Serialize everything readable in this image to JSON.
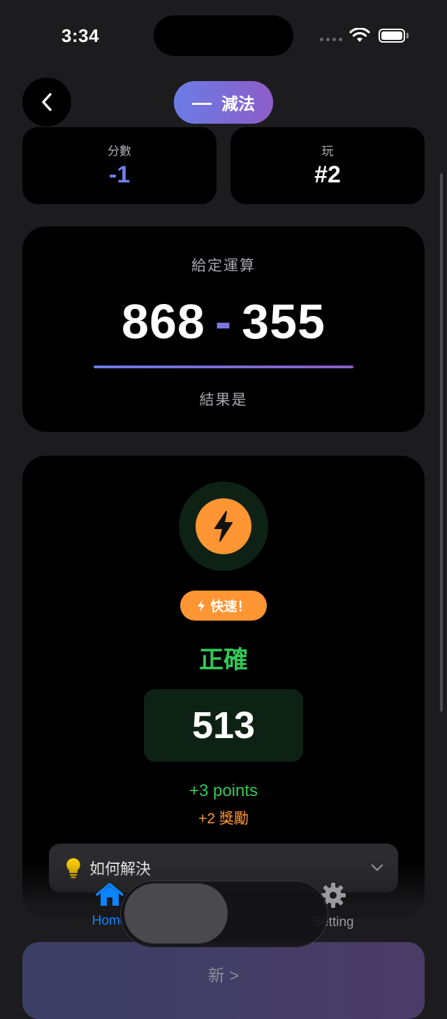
{
  "status_bar": {
    "time": "3:34"
  },
  "header": {
    "mode_symbol": "—",
    "mode_label": "減法"
  },
  "stats": {
    "score_label": "分數",
    "score_value": "-1",
    "play_label": "玩",
    "play_value": "#2"
  },
  "problem": {
    "label": "給定運算",
    "operand_a": "868",
    "operator": "-",
    "operand_b": "355",
    "result_label": "結果是"
  },
  "answer": {
    "badge": "快速！",
    "status": "正確",
    "value": "513",
    "points": "+3 points",
    "bonus": "+2 獎勵"
  },
  "howto": {
    "label": "如何解決"
  },
  "next_button": {
    "label": "新 >"
  },
  "tab_bar": {
    "home_label": "Home",
    "setting_label": "Setting"
  },
  "colors": {
    "accent": "#7080e8",
    "success": "#34c759",
    "warning": "#ff9533",
    "tab_active": "#0a84ff"
  }
}
